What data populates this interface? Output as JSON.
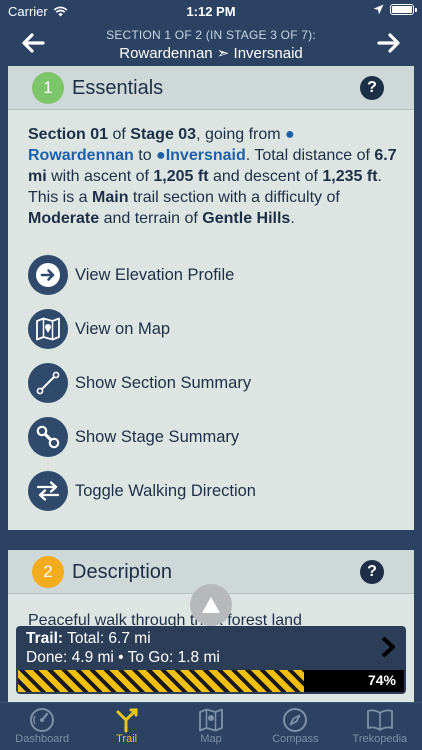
{
  "status": {
    "carrier": "Carrier",
    "time": "1:12 PM"
  },
  "header": {
    "section_line": "SECTION 1 OF 2 (IN STAGE 3 OF 7):",
    "route": "Rowardennan ➣ Inversnaid"
  },
  "essentials": {
    "number": "1",
    "title": "Essentials",
    "help": "?",
    "summary": {
      "section": "Section 01",
      "of_stage": " of ",
      "stage": "Stage 03",
      "going_from": ", going from ",
      "from_place": "Rowardennan",
      "to": " to ",
      "to_place": "Inversnaid",
      "total_distance": ". Total distance of ",
      "distance": "6.7 mi",
      "with_ascent": " with ascent of ",
      "ascent": "1,205 ft",
      "descent_of": " and descent of ",
      "descent": "1,235 ft",
      "this_is_a": ". This is a ",
      "trail_type": "Main",
      "trail_section_with": " trail section with a difficulty of ",
      "difficulty": "Moderate",
      "terrain_of": " and terrain of ",
      "terrain": "Gentle Hills",
      "end": "."
    },
    "actions": [
      {
        "label": "View Elevation Profile",
        "icon": "arrow-right-icon"
      },
      {
        "label": "View on Map",
        "icon": "map-icon"
      },
      {
        "label": "Show Section Summary",
        "icon": "section-line-icon"
      },
      {
        "label": "Show Stage Summary",
        "icon": "stage-link-icon"
      },
      {
        "label": "Toggle Walking Direction",
        "icon": "swap-arrows-icon"
      }
    ]
  },
  "description": {
    "number": "2",
    "title": "Description",
    "help": "?",
    "text": "Peaceful walk through thick forest land"
  },
  "progress": {
    "trail_label": "Trail:",
    "total_text": "Total: 6.7 mi",
    "done_text": "Done: 4.9 mi • To Go: 1.8 mi",
    "percent": 74,
    "percent_label": "74%"
  },
  "tabs": [
    {
      "label": "Dashboard",
      "icon": "dashboard-gauge-icon"
    },
    {
      "label": "Trail",
      "icon": "trail-fork-icon",
      "active": true
    },
    {
      "label": "Map",
      "icon": "map-icon"
    },
    {
      "label": "Compass",
      "icon": "compass-icon"
    },
    {
      "label": "Trekopedia",
      "icon": "book-icon"
    }
  ],
  "colors": {
    "navy": "#2b4262",
    "essentials_badge": "#7cc56a",
    "description_badge": "#f2ac1c",
    "link_blue": "#1f5fa8",
    "active_tab": "#e8c620"
  }
}
